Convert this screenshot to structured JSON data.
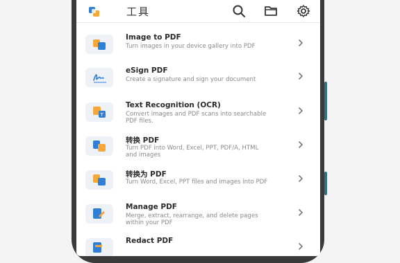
{
  "header": {
    "title": "工具",
    "logo_icon": "app-logo-icon",
    "actions": [
      "search-icon",
      "folder-icon",
      "gear-icon"
    ]
  },
  "colors": {
    "accent_blue": "#2f7fd6",
    "accent_orange": "#f5a83a",
    "icon_bg": "#eef1f6"
  },
  "tools": [
    {
      "title": "Image to PDF",
      "desc": "Turn images in your device gallery into PDF",
      "icon": "image-to-pdf-icon"
    },
    {
      "title": "eSign PDF",
      "desc": "Create a signature and sign your document",
      "icon": "signature-icon"
    },
    {
      "title": "Text Recognition (OCR)",
      "desc": "Convert images and PDF scans into searchable PDF files.",
      "icon": "ocr-icon"
    },
    {
      "title": "转换 PDF",
      "desc": "Turn PDF into Word, Excel, PPT, PDF/A, HTML and images",
      "icon": "convert-from-pdf-icon"
    },
    {
      "title": "转换为 PDF",
      "desc": "Turn Word, Excel, PPT files and images into PDF",
      "icon": "convert-to-pdf-icon"
    },
    {
      "title": "Manage PDF",
      "desc": "Merge, extract, rearrange, and delete pages within your PDF",
      "icon": "manage-pdf-icon"
    },
    {
      "title": "Redact PDF",
      "desc": "",
      "icon": "redact-pdf-icon"
    }
  ]
}
